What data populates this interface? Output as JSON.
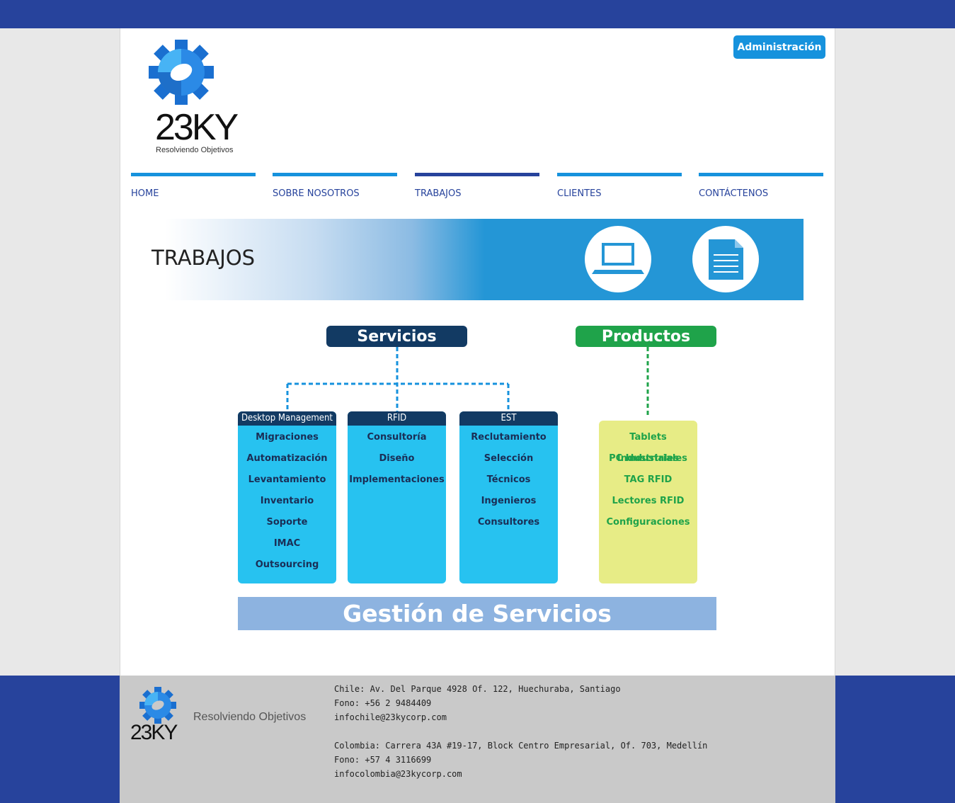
{
  "header": {
    "admin_label": "Administración",
    "logo_text": "23KY",
    "logo_tagline": "Resolviendo Objetivos"
  },
  "nav": {
    "items": [
      {
        "label": "HOME",
        "active": false
      },
      {
        "label": "SOBRE NOSOTROS",
        "active": false
      },
      {
        "label": "TRABAJOS",
        "active": true
      },
      {
        "label": "CLIENTES",
        "active": false
      },
      {
        "label": "CONTÁCTENOS",
        "active": false
      }
    ]
  },
  "banner": {
    "title": "TRABAJOS",
    "icons": [
      "laptop-icon",
      "document-icon"
    ]
  },
  "diagram": {
    "servicios": {
      "title": "Servicios",
      "columns": [
        {
          "title": "Desktop Management",
          "items": [
            "Migraciones",
            "Automatización",
            "Levantamiento",
            "Inventario",
            "Soporte",
            "IMAC",
            "Outsourcing"
          ]
        },
        {
          "title": "RFID",
          "items": [
            "Consultoría",
            "Diseño",
            "Implementaciones"
          ]
        },
        {
          "title": "EST",
          "items": [
            "Reclutamiento",
            "Selección",
            "Técnicos",
            "Ingenieros",
            "Consultores"
          ]
        }
      ]
    },
    "productos": {
      "title": "Productos",
      "items": [
        "Tablets Industriales",
        "PC Industriales",
        "TAG RFID",
        "Lectores RFID",
        "Configuraciones"
      ]
    },
    "bottom_label": "Gestión de Servicios"
  },
  "footer": {
    "logo_text": "23KY",
    "tagline": "Resolviendo Objetivos",
    "chile": {
      "address": "Chile: Av. Del Parque 4928 Of. 122, Huechuraba, Santiago",
      "phone": "Fono: +56 2 9484409",
      "email": "infochile@23kycorp.com"
    },
    "colombia": {
      "address": "Colombia: Carrera 43A #19-17, Block Centro Empresarial, Of. 703, Medellín",
      "phone": "Fono: +57 4 3116699",
      "email": "infocolombia@23kycorp.com"
    }
  },
  "colors": {
    "brand_blue": "#27439c",
    "accent_blue": "#1692dd",
    "servicios_header": "#123a63",
    "productos_header": "#1fa34a",
    "column_fill": "#27c2f0",
    "productos_fill": "#e7ec86",
    "gestion_fill": "#8db3e0"
  }
}
